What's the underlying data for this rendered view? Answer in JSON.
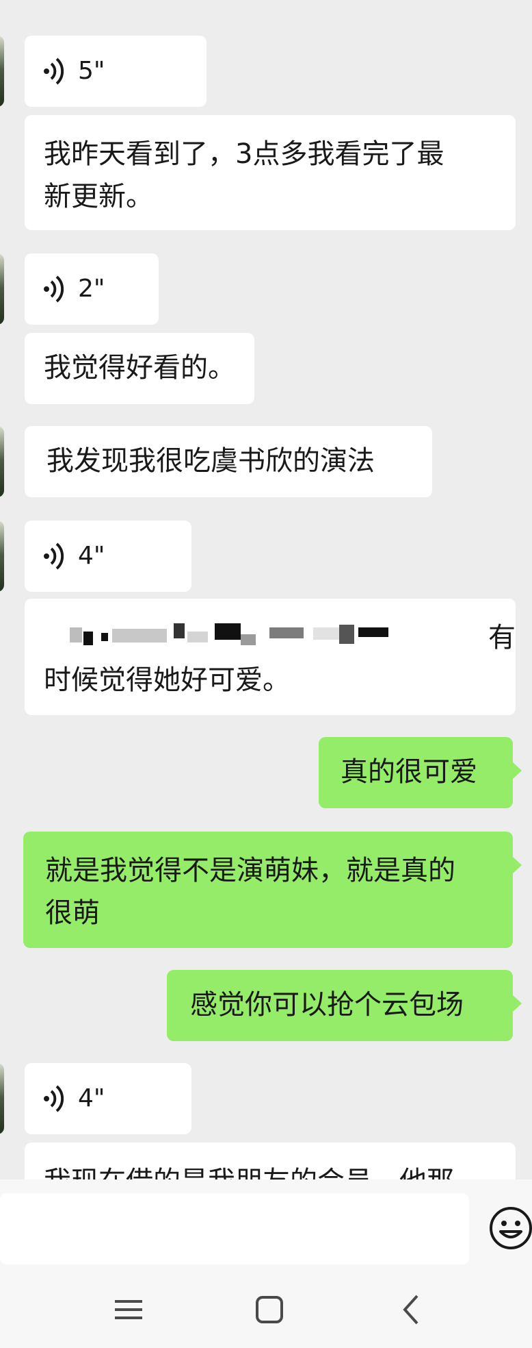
{
  "messages": [
    {
      "type": "voice",
      "side": "in",
      "duration": "5\""
    },
    {
      "type": "text",
      "side": "in",
      "lines": [
        "我昨天看到了，3点多我看完了最",
        "新更新。"
      ]
    },
    {
      "type": "voice",
      "side": "in",
      "duration": "2\""
    },
    {
      "type": "text",
      "side": "in",
      "lines": [
        "我觉得好看的。"
      ]
    },
    {
      "type": "text",
      "side": "in",
      "lines": [
        "我发现我很吃虞书欣的演法"
      ]
    },
    {
      "type": "voice",
      "side": "in",
      "duration": "4\""
    },
    {
      "type": "text",
      "side": "in",
      "lines": [
        "有",
        "时候觉得她好可爱。"
      ],
      "note_visible": "first line partially pixelated"
    },
    {
      "type": "text",
      "side": "out",
      "lines": [
        "真的很可爱"
      ]
    },
    {
      "type": "text",
      "side": "out",
      "lines": [
        "就是我觉得不是演萌妹，就是真的",
        "很萌"
      ]
    },
    {
      "type": "text",
      "side": "out",
      "lines": [
        "感觉你可以抢个云包场"
      ]
    },
    {
      "type": "voice",
      "side": "in",
      "duration": "4\""
    },
    {
      "type": "text",
      "side": "in",
      "lines": [
        "我现在借的是我朋友的会员，他那"
      ]
    }
  ],
  "input": {
    "value": ""
  },
  "icons": {
    "voice": "voice-wave-icon",
    "emoji": "emoji-icon",
    "menu": "menu-icon",
    "home": "home-icon",
    "back": "back-icon"
  },
  "colors": {
    "background": "#ededed",
    "incoming": "#ffffff",
    "outgoing": "#95ec69",
    "text": "#191919"
  }
}
